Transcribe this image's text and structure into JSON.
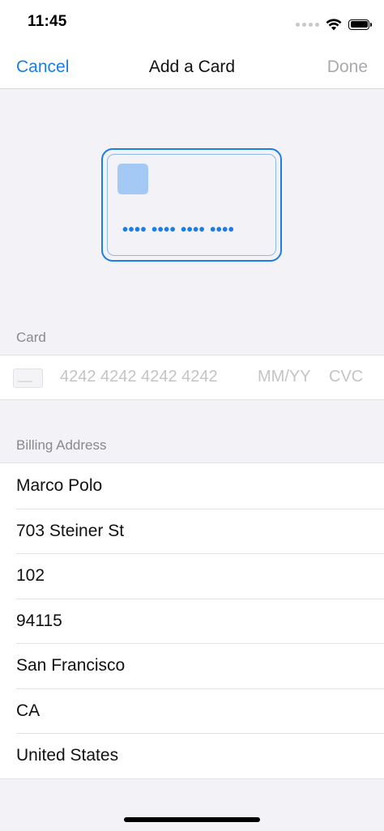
{
  "status_bar": {
    "time": "11:45",
    "signal_icon": "cellular-signal-icon",
    "wifi_icon": "wifi-icon",
    "battery_icon": "battery-icon"
  },
  "nav": {
    "cancel_label": "Cancel",
    "title": "Add a Card",
    "done_label": "Done"
  },
  "card_preview": {
    "number_mask": "•••• •••• •••• ••••"
  },
  "card_section": {
    "header": "Card",
    "number_placeholder": "4242 4242 4242 4242",
    "expiry_placeholder": "MM/YY",
    "cvc_placeholder": "CVC"
  },
  "billing_section": {
    "header": "Billing Address",
    "fields": [
      {
        "value": "Marco Polo"
      },
      {
        "value": "703 Steiner St"
      },
      {
        "value": "102"
      },
      {
        "value": "94115"
      },
      {
        "value": "San Francisco"
      },
      {
        "value": "CA"
      },
      {
        "value": "United States"
      }
    ]
  },
  "colors": {
    "accent": "#1a7ee6",
    "disabled": "#a9a9ae",
    "background": "#f2f2f7",
    "placeholder": "#c4c4c8"
  }
}
